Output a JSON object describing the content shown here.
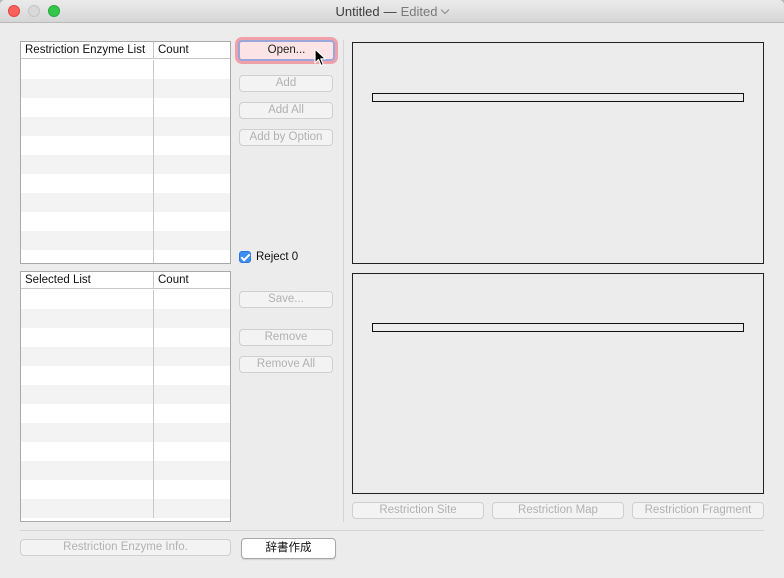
{
  "window": {
    "title": "Untitled",
    "separator": "—",
    "status": "Edited"
  },
  "enzyme_table": {
    "headers": [
      "Restriction Enzyme List",
      "Count"
    ],
    "row_count": 11
  },
  "selected_table": {
    "headers": [
      "Selected List",
      "Count"
    ],
    "row_count": 12
  },
  "buttons": {
    "open": "Open...",
    "add": "Add",
    "add_all": "Add All",
    "add_by_option": "Add by Option",
    "save": "Save...",
    "remove": "Remove",
    "remove_all": "Remove All",
    "restriction_site": "Restriction Site",
    "restriction_map": "Restriction Map",
    "restriction_fragment": "Restriction Fragment",
    "enzyme_info": "Restriction Enzyme Info.",
    "dictionary": "辞書作成"
  },
  "checkbox": {
    "label": "Reject 0",
    "checked": true
  },
  "colors": {
    "close": "#fc605b",
    "zoom": "#34c84a",
    "checkbox": "#3d8ef6",
    "open_highlight": "#f0a0a8"
  }
}
